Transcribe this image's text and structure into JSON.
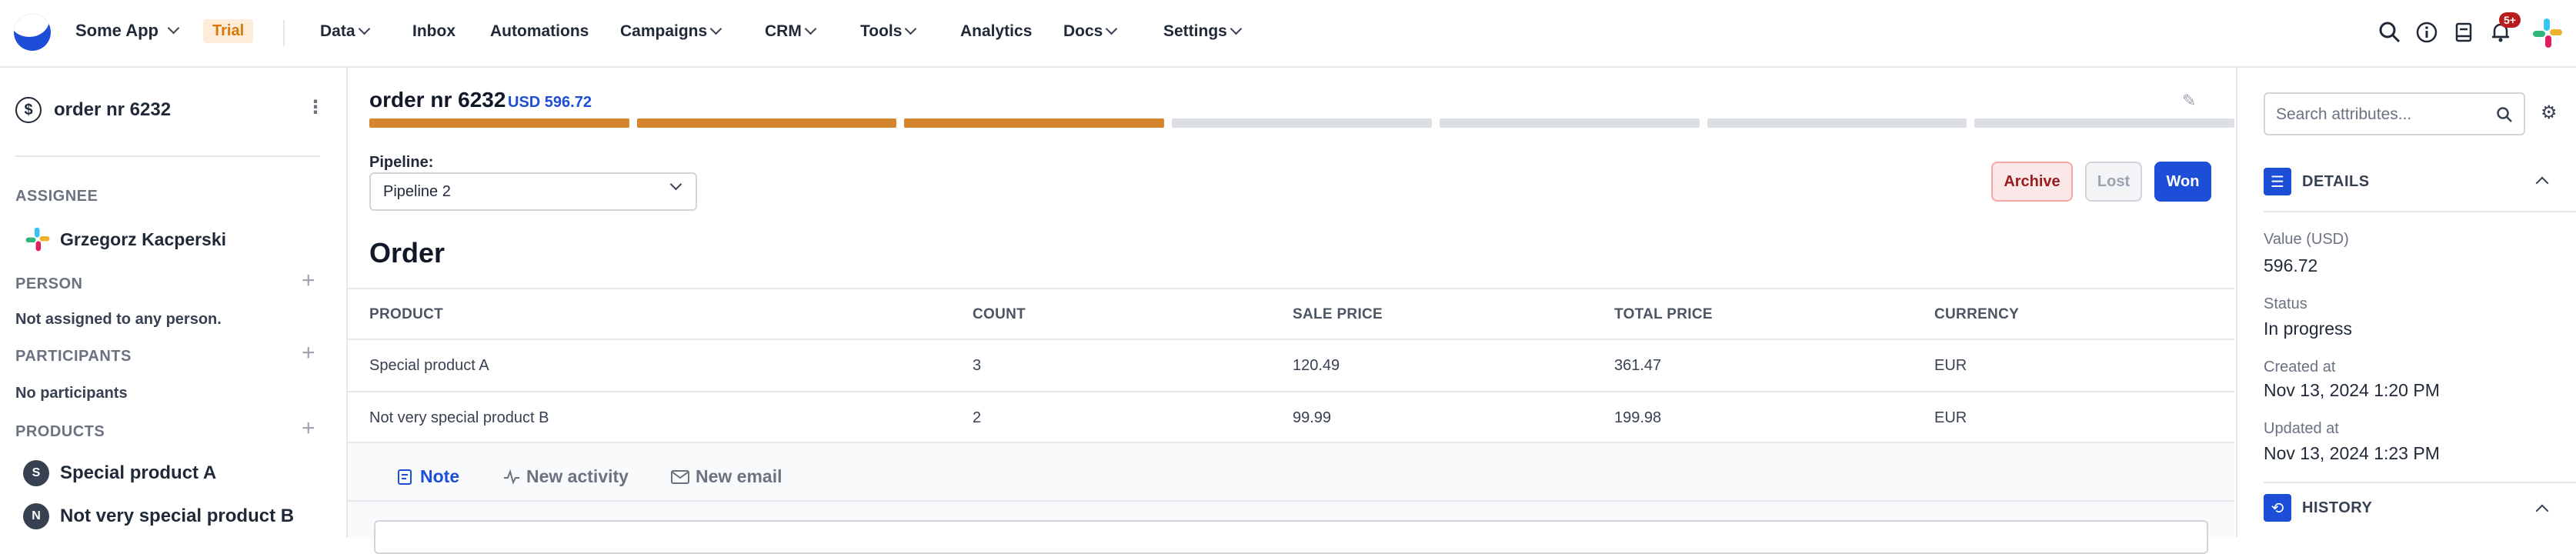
{
  "header": {
    "app_name": "Some App",
    "trial_badge": "Trial",
    "nav": [
      {
        "label": "Data",
        "dropdown": true
      },
      {
        "label": "Inbox",
        "dropdown": false
      },
      {
        "label": "Automations",
        "dropdown": false
      },
      {
        "label": "Campaigns",
        "dropdown": true
      },
      {
        "label": "CRM",
        "dropdown": true
      },
      {
        "label": "Tools",
        "dropdown": true
      },
      {
        "label": "Analytics",
        "dropdown": false
      },
      {
        "label": "Docs",
        "dropdown": true
      },
      {
        "label": "Settings",
        "dropdown": true
      }
    ],
    "notification_badge": "5+"
  },
  "sidebar": {
    "title": "order nr 6232",
    "assignee_label": "ASSIGNEE",
    "assignee_name": "Grzegorz Kacperski",
    "person_label": "PERSON",
    "person_empty": "Not assigned to any person.",
    "participants_label": "PARTICIPANTS",
    "participants_empty": "No participants",
    "products_label": "PRODUCTS",
    "products": [
      {
        "initial": "S",
        "name": "Special product A"
      },
      {
        "initial": "N",
        "name": "Not very special product B"
      }
    ]
  },
  "main": {
    "order_title": "order nr 6232",
    "order_value": "USD 596.72",
    "stages_done": 3,
    "stages_total": 7,
    "colors": {
      "stage_done": "#d5852c",
      "stage_todo": "#dcdfe5",
      "accent": "#1d4ed8"
    },
    "pipeline_label": "Pipeline:",
    "pipeline_value": "Pipeline 2",
    "buttons": {
      "archive": "Archive",
      "lost": "Lost",
      "won": "Won"
    },
    "section_title": "Order",
    "table": {
      "headers": [
        "PRODUCT",
        "COUNT",
        "SALE PRICE",
        "TOTAL PRICE",
        "CURRENCY"
      ],
      "rows": [
        [
          "Special product A",
          "3",
          "120.49",
          "361.47",
          "EUR"
        ],
        [
          "Not very special product B",
          "2",
          "99.99",
          "199.98",
          "EUR"
        ]
      ]
    },
    "tabs": [
      {
        "label": "Note",
        "icon": "note-icon",
        "active": true
      },
      {
        "label": "New activity",
        "icon": "activity-icon",
        "active": false
      },
      {
        "label": "New email",
        "icon": "mail-icon",
        "active": false
      }
    ]
  },
  "rpanel": {
    "search_placeholder": "Search attributes...",
    "details_label": "DETAILS",
    "attributes": [
      {
        "label": "Value (USD)",
        "value": "596.72"
      },
      {
        "label": "Status",
        "value": "In progress"
      },
      {
        "label": "Created at",
        "value": "Nov 13, 2024 1:20 PM"
      },
      {
        "label": "Updated at",
        "value": "Nov 13, 2024 1:23 PM"
      }
    ],
    "history_label": "HISTORY"
  }
}
